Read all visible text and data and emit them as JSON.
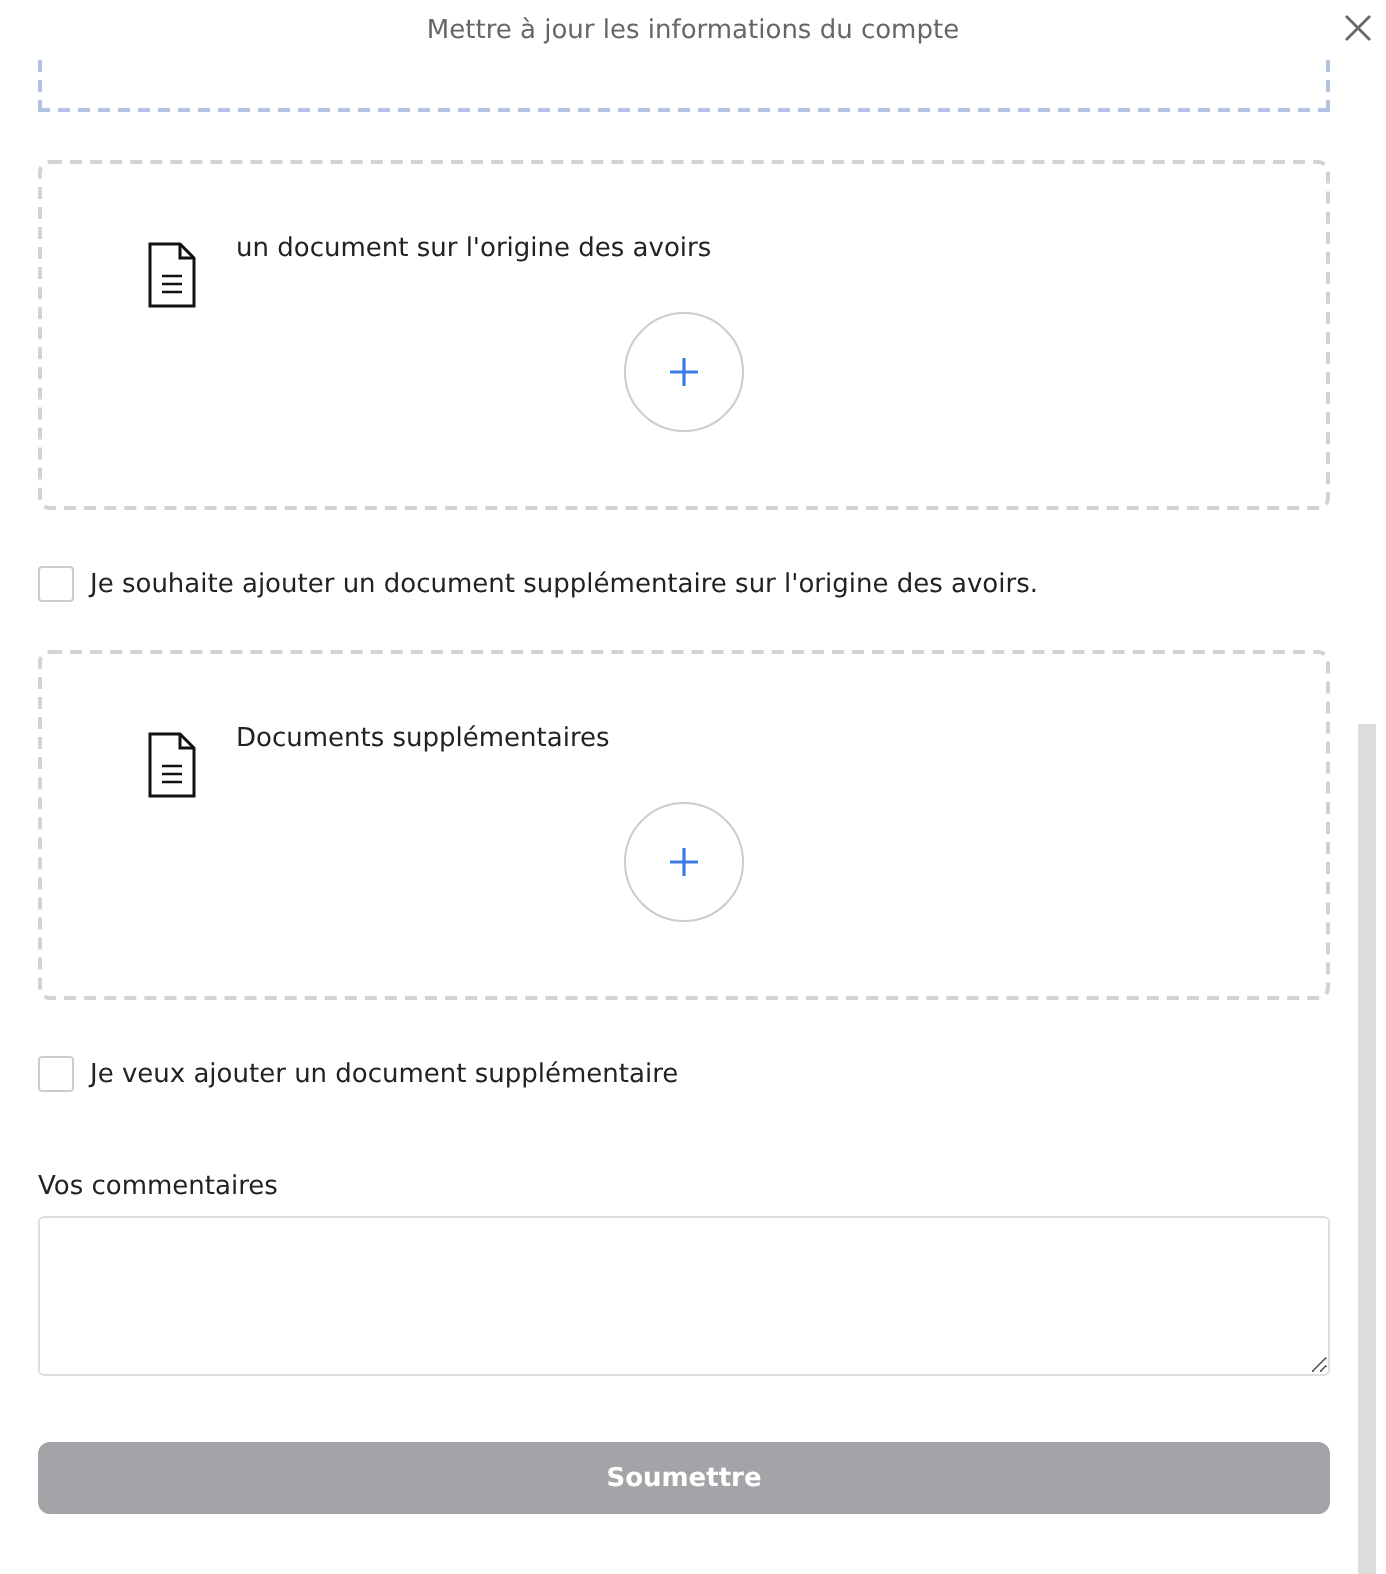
{
  "dialog": {
    "title": "Mettre à jour les informations du compte"
  },
  "sections": [
    {
      "kind": "upload",
      "label": "un document sur l'origine des avoirs"
    },
    {
      "kind": "checkbox",
      "label": "Je souhaite ajouter un document supplémentaire sur l'origine des avoirs.",
      "checked": false
    },
    {
      "kind": "upload",
      "label": "Documents supplémentaires"
    },
    {
      "kind": "checkbox",
      "label": "Je veux ajouter un document supplémentaire",
      "checked": false
    }
  ],
  "comments": {
    "label": "Vos commentaires"
  },
  "submit": {
    "label": "Soumettre",
    "disabled": true
  }
}
